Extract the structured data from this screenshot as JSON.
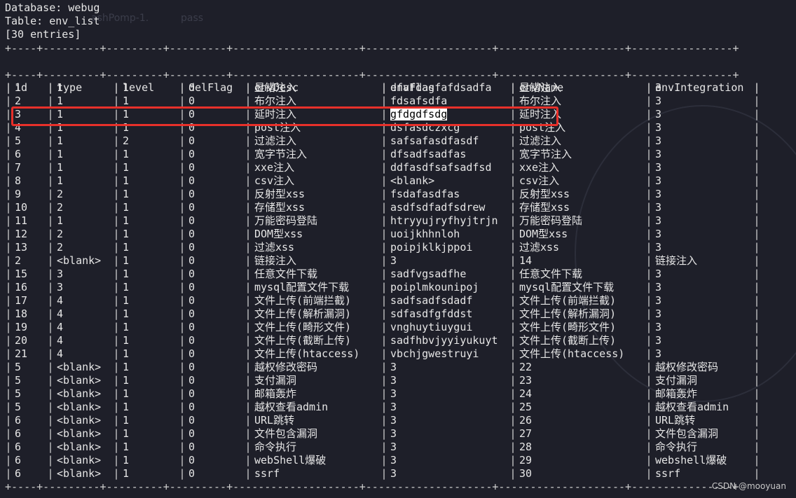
{
  "meta": {
    "database_line": "Database: webug",
    "table_line": "Table: env_list",
    "count_line": "[30 entries]"
  },
  "separator": "+----+---------+---------+---------+----------------------+---------------------+----------------------+----------------+",
  "columns": [
    "id",
    "type",
    "level",
    "delFlag",
    "envDesc",
    "envFlag",
    "envName",
    "envIntegration"
  ],
  "rows": [
    [
      "1",
      "1",
      "1",
      "0",
      "显错注入",
      "dfafdasfafdsadfa",
      "显错注入",
      "3"
    ],
    [
      "2",
      "1",
      "1",
      "0",
      "布尔注入",
      "fdsafsdfa",
      "布尔注入",
      "3"
    ],
    [
      "3",
      "1",
      "1",
      "0",
      "延时注入",
      "gfdgdfsdg",
      "延时注入",
      "3"
    ],
    [
      "4",
      "1",
      "1",
      "0",
      "post注入",
      "dsfasdczxcg",
      "post注入",
      "3"
    ],
    [
      "5",
      "1",
      "2",
      "0",
      "过滤注入",
      "safsafasdfasdf",
      "过滤注入",
      "3"
    ],
    [
      "6",
      "1",
      "1",
      "0",
      "宽字节注入",
      "dfsadfsadfas",
      "宽字节注入",
      "3"
    ],
    [
      "7",
      "1",
      "1",
      "0",
      "xxe注入",
      "ddfasdfsafsadfsd",
      "xxe注入",
      "3"
    ],
    [
      "8",
      "1",
      "1",
      "0",
      "csv注入",
      "<blank>",
      "csv注入",
      "3"
    ],
    [
      "9",
      "2",
      "1",
      "0",
      "反射型xss",
      "fsdafasdfas",
      "反射型xss",
      "3"
    ],
    [
      "10",
      "2",
      "1",
      "0",
      "存储型xss",
      "asdfsdfadfsdrew",
      "存储型xss",
      "3"
    ],
    [
      "11",
      "1",
      "1",
      "0",
      "万能密码登陆",
      "htryyujryfhyjtrjn",
      "万能密码登陆",
      "3"
    ],
    [
      "12",
      "2",
      "1",
      "0",
      "DOM型xss",
      "uoijkhhnloh",
      "DOM型xss",
      "3"
    ],
    [
      "13",
      "2",
      "1",
      "0",
      "过滤xss",
      "poipjklkjppoi",
      "过滤xss",
      "3"
    ],
    [
      "2",
      "<blank>",
      "1",
      "0",
      "链接注入",
      "3",
      "14",
      "链接注入"
    ],
    [
      "15",
      "3",
      "1",
      "0",
      "任意文件下载",
      "sadfvgsadfhe",
      "任意文件下载",
      "3"
    ],
    [
      "16",
      "3",
      "1",
      "0",
      "mysql配置文件下载",
      "poiplmkounipoj",
      "mysql配置文件下载",
      "3"
    ],
    [
      "17",
      "4",
      "1",
      "0",
      "文件上传(前端拦截)",
      "sadfsadfsdadf",
      "文件上传(前端拦截)",
      "3"
    ],
    [
      "18",
      "4",
      "1",
      "0",
      "文件上传(解析漏洞)",
      "sdfasdfgfddst",
      "文件上传(解析漏洞)",
      "3"
    ],
    [
      "19",
      "4",
      "1",
      "0",
      "文件上传(畸形文件)",
      "vnghuytiuygui",
      "文件上传(畸形文件)",
      "3"
    ],
    [
      "20",
      "4",
      "1",
      "0",
      "文件上传(截断上传)",
      "sadfhbvjyyiyukuyt",
      "文件上传(截断上传)",
      "3"
    ],
    [
      "21",
      "4",
      "1",
      "0",
      "文件上传(htaccess)",
      "vbchjgwestruyi",
      "文件上传(htaccess)",
      "3"
    ],
    [
      "5",
      "<blank>",
      "1",
      "0",
      "越权修改密码",
      "3",
      "22",
      "越权修改密码"
    ],
    [
      "5",
      "<blank>",
      "1",
      "0",
      "支付漏洞",
      "3",
      "23",
      "支付漏洞"
    ],
    [
      "5",
      "<blank>",
      "1",
      "0",
      "邮箱轰炸",
      "3",
      "24",
      "邮箱轰炸"
    ],
    [
      "5",
      "<blank>",
      "1",
      "0",
      "越权查看admin",
      "3",
      "25",
      "越权查看admin"
    ],
    [
      "6",
      "<blank>",
      "1",
      "0",
      "URL跳转",
      "3",
      "26",
      "URL跳转"
    ],
    [
      "6",
      "<blank>",
      "1",
      "0",
      "文件包含漏洞",
      "3",
      "27",
      "文件包含漏洞"
    ],
    [
      "6",
      "<blank>",
      "1",
      "0",
      "命令执行",
      "3",
      "28",
      "命令执行"
    ],
    [
      "6",
      "<blank>",
      "1",
      "0",
      "webShell爆破",
      "3",
      "29",
      "webshell爆破"
    ],
    [
      "6",
      "<blank>",
      "1",
      "0",
      "ssrf",
      "3",
      "30",
      "ssrf"
    ]
  ],
  "highlighted_row_index": 2,
  "highlighted_cell_text": "gfdgdfsdg",
  "watermark": "CSDN @mooyuan",
  "colors": {
    "background": "#1e1f29",
    "text": "#e6e6e6",
    "highlight_border": "#e8302a"
  }
}
